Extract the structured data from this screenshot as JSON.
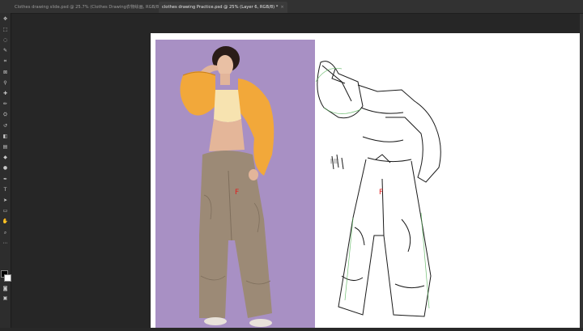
{
  "tabs": [
    {
      "label": "Clothes drawing slide.psd @ 25.7% (Clothes Drawing衣物绘画, RGB/8) *",
      "close": "×",
      "active": false
    },
    {
      "label": "clothes drawing Practice.psd @ 25% (Layer 6, RGB/8) *",
      "close": "×",
      "active": true
    }
  ],
  "tools": [
    {
      "name": "move-tool-icon",
      "glyph": "✥"
    },
    {
      "name": "marquee-tool-icon",
      "glyph": "⬚"
    },
    {
      "name": "lasso-tool-icon",
      "glyph": "◌"
    },
    {
      "name": "quick-select-tool-icon",
      "glyph": "✎"
    },
    {
      "name": "crop-tool-icon",
      "glyph": "⌗"
    },
    {
      "name": "frame-tool-icon",
      "glyph": "⊠"
    },
    {
      "name": "eyedropper-tool-icon",
      "glyph": "⚲"
    },
    {
      "name": "healing-brush-tool-icon",
      "glyph": "✚"
    },
    {
      "name": "brush-tool-icon",
      "glyph": "✏"
    },
    {
      "name": "clone-stamp-tool-icon",
      "glyph": "⛭"
    },
    {
      "name": "history-brush-tool-icon",
      "glyph": "↺"
    },
    {
      "name": "eraser-tool-icon",
      "glyph": "◧"
    },
    {
      "name": "gradient-tool-icon",
      "glyph": "▤"
    },
    {
      "name": "blur-tool-icon",
      "glyph": "◆"
    },
    {
      "name": "dodge-tool-icon",
      "glyph": "●"
    },
    {
      "name": "pen-tool-icon",
      "glyph": "✒"
    },
    {
      "name": "type-tool-icon",
      "glyph": "T"
    },
    {
      "name": "path-select-tool-icon",
      "glyph": "➤"
    },
    {
      "name": "rectangle-tool-icon",
      "glyph": "▭"
    },
    {
      "name": "hand-tool-icon",
      "glyph": "✋"
    },
    {
      "name": "zoom-tool-icon",
      "glyph": "⌕"
    },
    {
      "name": "more-tools-icon",
      "glyph": "⋯"
    }
  ],
  "extra_tools": [
    {
      "name": "quick-mask-icon",
      "glyph": "◙"
    },
    {
      "name": "screen-mode-icon",
      "glyph": "▣"
    }
  ],
  "colors": {
    "foreground": "#000000",
    "background": "#ffffff",
    "photo_backdrop": "#a890c4",
    "jacket": "#f2a83a",
    "pants": "#9c8a76",
    "annotation_red": "#e02020"
  },
  "canvas": {
    "annotation_left": "F",
    "annotation_right": "F",
    "sketch_marks": "|  |||"
  }
}
